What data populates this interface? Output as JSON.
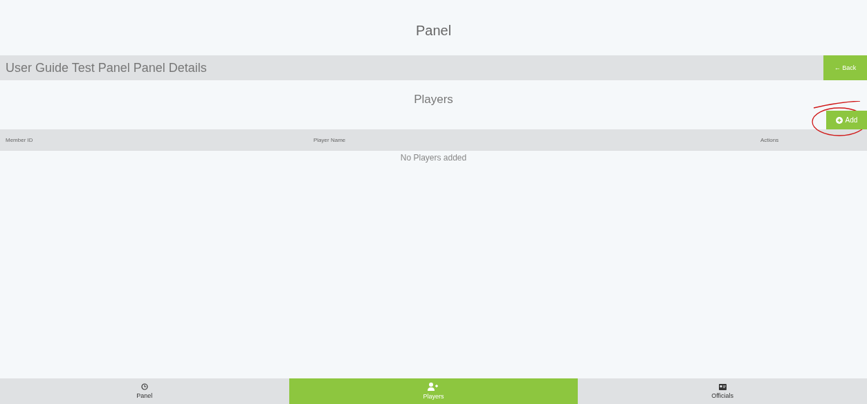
{
  "header": {
    "title": "Panel"
  },
  "title_bar": {
    "title": "User Guide Test Panel Panel Details",
    "back_button": "← Back"
  },
  "section": {
    "title": "Players",
    "add_button": "Add"
  },
  "table": {
    "columns": [
      "Member ID",
      "Player Name",
      "Actions"
    ],
    "empty_message": "No Players added"
  },
  "bottom_nav": [
    {
      "label": "Panel",
      "kind": "panel",
      "selected": false
    },
    {
      "label": "Players",
      "kind": "players",
      "selected": true
    },
    {
      "label": "Officials",
      "kind": "officials",
      "selected": false
    }
  ]
}
